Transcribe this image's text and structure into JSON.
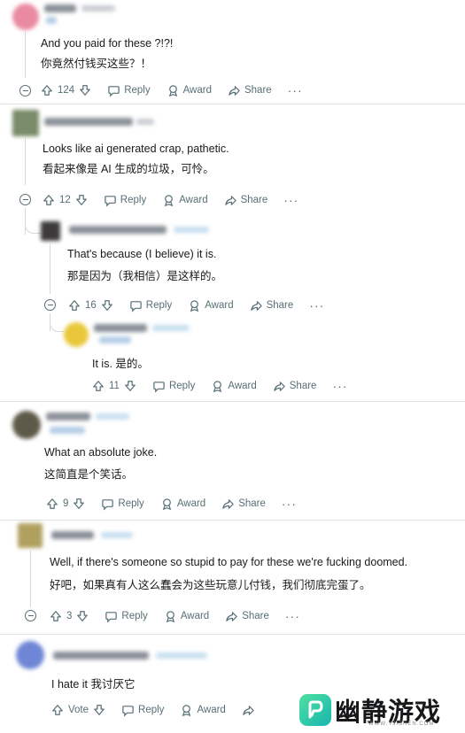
{
  "actions": {
    "reply": "Reply",
    "award": "Award",
    "share": "Share",
    "more": "···"
  },
  "comments": [
    {
      "text_en": "And you paid for these ?!?!",
      "text_zh": "你竟然付钱买这些？！",
      "votes": "124"
    },
    {
      "text_en": "Looks like ai generated crap, pathetic.",
      "text_zh": "看起来像是 AI 生成的垃圾，可怜。",
      "votes": "12"
    },
    {
      "text_en": "That's because (I believe) it is.",
      "text_zh": "那是因为（我相信）是这样的。",
      "votes": "16"
    },
    {
      "text_en": "It is.  是的。",
      "votes": "11"
    },
    {
      "text_en": "What an absolute joke.",
      "text_zh": "这简直是个笑话。",
      "votes": "9"
    },
    {
      "text_en": "Well, if there's someone so stupid to pay for these we're fucking doomed.",
      "text_zh": "好吧，如果真有人这么蠢会为这些玩意儿付钱，我们彻底完蛋了。",
      "votes": "3"
    },
    {
      "text_en": "I hate it   我讨厌它",
      "votes": "Vote"
    }
  ],
  "watermark": {
    "brand": "幽静游戏",
    "url": "WWW.YJISREN.COM"
  },
  "colors": {
    "meta_text": "#576f76",
    "thread_line": "#d4dadc",
    "logo_green": "#2ccfa6"
  }
}
